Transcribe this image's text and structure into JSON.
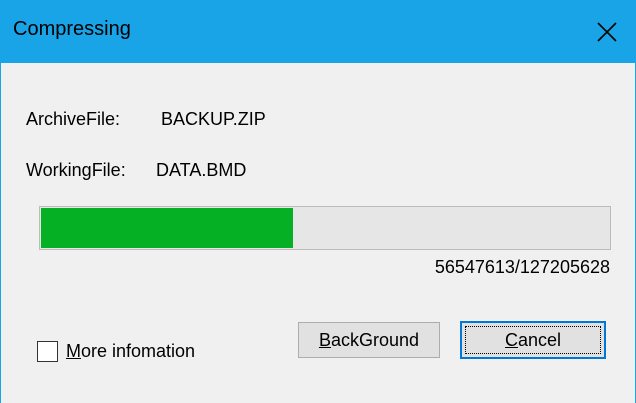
{
  "window": {
    "title": "Compressing",
    "close_icon": "close-icon",
    "accent_color": "#1aa4e8"
  },
  "archive": {
    "label": "ArchiveFile:",
    "value": "BACKUP.ZIP"
  },
  "working": {
    "label": "WorkingFile:",
    "value": "DATA.BMD"
  },
  "progress": {
    "current": 56547613,
    "total": 127205628,
    "counter_text": "56547613/127205628",
    "fill_color": "#06b025"
  },
  "options": {
    "more_info_mnemonic": "M",
    "more_info_rest": "ore infomation",
    "more_info_checked": false
  },
  "buttons": {
    "background_mnemonic": "B",
    "background_rest": "ackGround",
    "cancel_mnemonic": "C",
    "cancel_rest": "ancel"
  }
}
